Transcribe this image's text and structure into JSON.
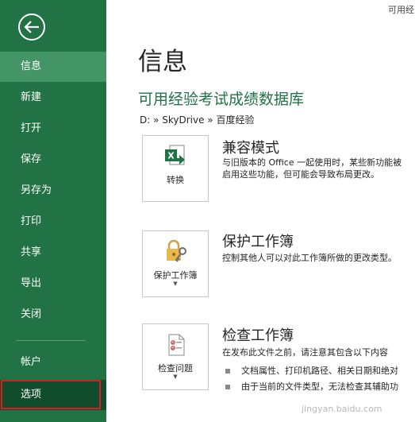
{
  "sidebar": {
    "items": [
      {
        "label": "信息"
      },
      {
        "label": "新建"
      },
      {
        "label": "打开"
      },
      {
        "label": "保存"
      },
      {
        "label": "另存为"
      },
      {
        "label": "打印"
      },
      {
        "label": "共享"
      },
      {
        "label": "导出"
      },
      {
        "label": "关闭"
      },
      {
        "label": "帐户"
      },
      {
        "label": "选项"
      }
    ]
  },
  "header": {
    "top_right": "可用经"
  },
  "main": {
    "title": "信息",
    "doc_title": "可用经验考试成绩数据库",
    "breadcrumb": "D: » SkyDrive » 百度经验",
    "sections": [
      {
        "button_label": "转换",
        "title": "兼容模式",
        "desc1": "与旧版本的 Office 一起使用时，某些新功能被",
        "desc2": "启用这些功能，但可能会导致布局更改。"
      },
      {
        "button_label": "保护工作簿",
        "title": "保护工作簿",
        "desc1": "控制其他人可以对此工作簿所做的更改类型。"
      },
      {
        "button_label": "检查问题",
        "title": "检查工作簿",
        "desc1": "在发布此文件之前，请注意其包含以下内容",
        "bullets": [
          "文档属性、打印机路径、相关日期和绝对",
          "由于当前的文件类型，无法检查其辅助功"
        ]
      }
    ]
  },
  "watermark": "jingyan.baidu.com",
  "colors": {
    "sidebar": "#217346",
    "active": "#439467",
    "accent": "#217346",
    "highlight": "#e0191e"
  }
}
